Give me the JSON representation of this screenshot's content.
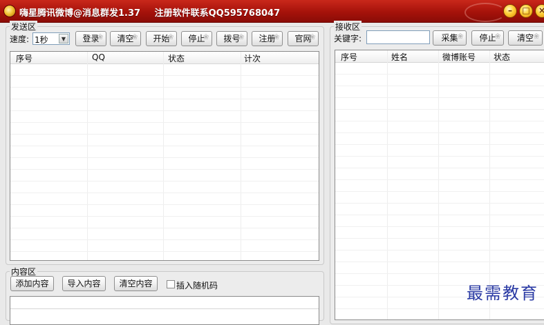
{
  "window": {
    "title": "嗨星腾讯微博@消息群发1.37",
    "register_note": "注册软件联系QQ595768047",
    "controls": {
      "minimize": "–",
      "restore": "□",
      "close": "×"
    }
  },
  "send_area": {
    "title": "发送区",
    "speed_label": "速度:",
    "speed_value": "1秒",
    "buttons": {
      "login": "登录",
      "clear": "清空",
      "start": "开始",
      "stop": "停止",
      "dial": "拨号",
      "register": "注册",
      "website": "官网"
    },
    "columns": [
      "序号",
      "QQ",
      "状态",
      "计次"
    ]
  },
  "content_area": {
    "title": "内容区",
    "buttons": {
      "add": "添加内容",
      "import": "导入内容",
      "clear": "清空内容"
    },
    "insert_random_label": "插入随机码",
    "insert_random_checked": false
  },
  "receive_area": {
    "title": "接收区",
    "keyword_label": "关键字:",
    "keyword_value": "",
    "buttons": {
      "collect": "采集",
      "stop": "停止",
      "clear": "清空"
    },
    "columns": [
      "序号",
      "姓名",
      "微博账号",
      "状态"
    ]
  },
  "watermark": "最需教育"
}
